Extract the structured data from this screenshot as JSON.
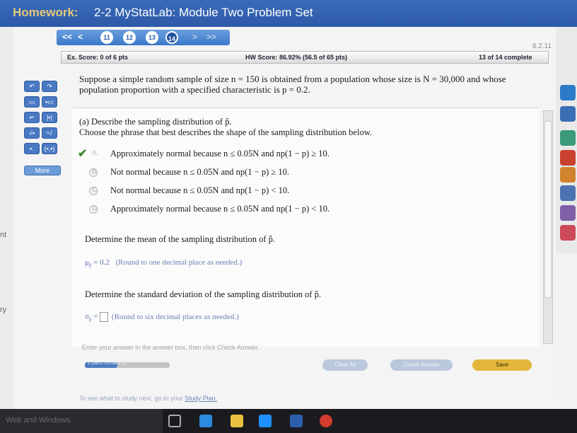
{
  "window": {
    "title_prefix": "Homework:",
    "title": "2-2 MyStatLab: Module Two Problem Set"
  },
  "left_strip": {
    "snippet_1": "nt",
    "snippet_2": "ry"
  },
  "nav": {
    "first": "<<",
    "prev": "<",
    "next": ">",
    "last": ">>",
    "questions": [
      "11",
      "12",
      "13",
      "14"
    ],
    "version": "6.2.11"
  },
  "score": {
    "ex": "Ex. Score: 0 of 6 pts",
    "hw": "HW Score: 86.92% (56.5 of 65 pts)",
    "complete": "13 of 14 complete"
  },
  "palette": {
    "more": "More"
  },
  "question": {
    "text": "Suppose a simple random sample of size n = 150 is obtained from a population whose size is N = 30,000 and whose population proportion with a specified characteristic is p = 0.2."
  },
  "part_a": {
    "prompt": "(a) Describe the sampling distribution of p̂.",
    "instruction": "Choose the phrase that best describes the shape of the sampling distribution below.",
    "options": [
      {
        "letter": "A.",
        "text": "Approximately normal because n ≤ 0.05N and np(1 − p) ≥ 10."
      },
      {
        "letter": "B.",
        "text": "Not normal because n ≤ 0.05N and np(1 − p) ≥ 10."
      },
      {
        "letter": "C.",
        "text": "Not normal because n ≤ 0.05N and np(1 − p) < 10."
      },
      {
        "letter": "D.",
        "text": "Approximately normal because n ≤ 0.05N and np(1 − p) < 10."
      }
    ]
  },
  "mean": {
    "prompt": "Determine the mean of the sampling distribution of p̂.",
    "symbol": "μ",
    "sub": "p̂",
    "equals": "= 0.2",
    "note": "(Round to one decimal place as needed.)"
  },
  "sd": {
    "prompt": "Determine the standard deviation of the sampling distribution of p̂.",
    "symbol": "σ",
    "sub": "p̂",
    "equals": "=",
    "note": "(Round to six decimal places as needed.)"
  },
  "footer": {
    "hint": "Enter your answer in the answer box, then click Check Answer.",
    "parts": "2 parts remaining",
    "parts_progress": 0.38,
    "clear": "Clear All",
    "check": "Check Answer",
    "save": "Save",
    "study_prefix": "To see what to study next, go to your",
    "study_link": "Study Plan."
  },
  "taskbar": {
    "search": "Web and Windows"
  }
}
